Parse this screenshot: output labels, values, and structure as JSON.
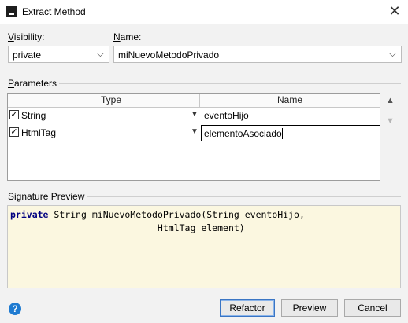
{
  "window": {
    "title": "Extract Method"
  },
  "visibility": {
    "label": "Visibility:",
    "value": "private"
  },
  "name": {
    "label": "Name:",
    "value": "miNuevoMetodoPrivado"
  },
  "parameters": {
    "title": "Parameters",
    "columns": [
      "Type",
      "Name"
    ],
    "rows": [
      {
        "checked": true,
        "type": "String",
        "name": "eventoHijo"
      },
      {
        "checked": true,
        "type": "HtmlTag",
        "name": "elementoAsociado",
        "editing": true
      }
    ]
  },
  "signature": {
    "title": "Signature Preview",
    "line1_keyword": "private",
    "line1_rest": " String miNuevoMetodoPrivado(String eventoHijo,",
    "line2": "                           HtmlTag element)"
  },
  "buttons": {
    "refactor": "Refactor",
    "preview": "Preview",
    "cancel": "Cancel"
  },
  "icons": {
    "help": "?",
    "close": "✕",
    "dropdown": "⌵",
    "move_up": "▲",
    "move_down": "▼",
    "check": "✓",
    "cell_dropdown": "▼"
  }
}
